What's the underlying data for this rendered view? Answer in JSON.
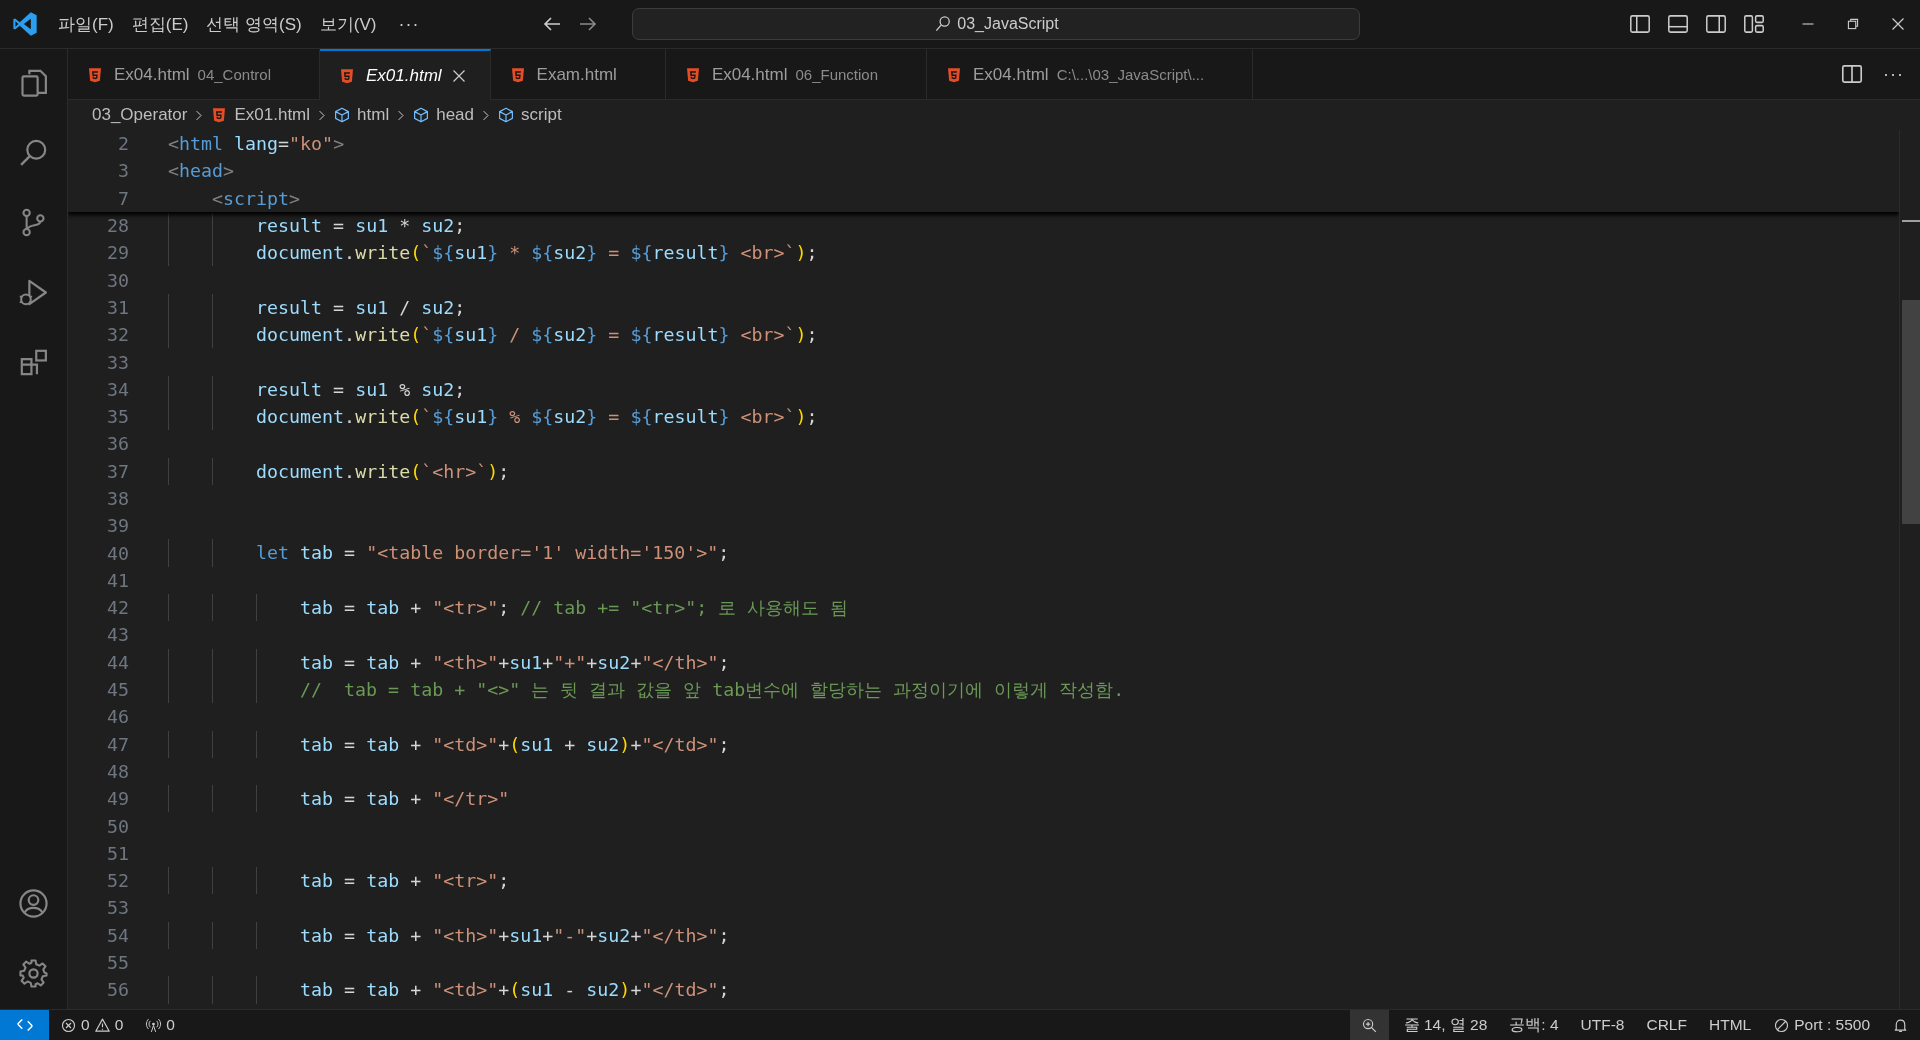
{
  "title_bar": {
    "menus": [
      "파일(F)",
      "편집(E)",
      "선택 영역(S)",
      "보기(V)"
    ],
    "more": "···",
    "search": "03_JavaScript"
  },
  "tabs": [
    {
      "name": "Ex04.html",
      "description": "04_Control",
      "selected": false,
      "preview": false
    },
    {
      "name": "Ex01.html",
      "selected": true,
      "preview": true
    },
    {
      "name": "Exam.html",
      "selected": false,
      "preview": false
    },
    {
      "name": "Ex04.html",
      "description": "06_Function",
      "selected": false,
      "preview": false
    },
    {
      "name": "Ex04.html",
      "description": "C:\\...\\03_JavaScript\\...",
      "selected": false,
      "preview": false
    }
  ],
  "tab_actions": {
    "more": "···"
  },
  "breadcrumbs": [
    {
      "kind": "folder",
      "text": "03_Operator"
    },
    {
      "kind": "file",
      "text": "Ex01.html"
    },
    {
      "kind": "symbol",
      "text": "html"
    },
    {
      "kind": "symbol",
      "text": "head"
    },
    {
      "kind": "symbol",
      "text": "script"
    }
  ],
  "sticky_lines": [
    {
      "number": "2",
      "tokens": [
        {
          "kind": "punct",
          "text": "<"
        },
        {
          "kind": "tag",
          "text": "html"
        },
        {
          "kind": "attr",
          "text": " lang"
        },
        {
          "kind": "plain",
          "text": "="
        },
        {
          "kind": "string",
          "text": "\"ko\""
        },
        {
          "kind": "punct",
          "text": ">"
        }
      ]
    },
    {
      "number": "3",
      "tokens": [
        {
          "kind": "punct",
          "text": "<"
        },
        {
          "kind": "tag",
          "text": "head"
        },
        {
          "kind": "punct",
          "text": ">"
        }
      ]
    },
    {
      "number": "7",
      "tokens": [
        {
          "kind": "punct",
          "text": "    <"
        },
        {
          "kind": "tag",
          "text": "script"
        },
        {
          "kind": "punct",
          "text": ">"
        }
      ]
    }
  ],
  "lines": [
    {
      "number": "28",
      "tokens": [
        {
          "kind": "variable",
          "text": "        result"
        },
        {
          "kind": "plain",
          "text": " = "
        },
        {
          "kind": "variable",
          "text": "su1"
        },
        {
          "kind": "plain",
          "text": " * "
        },
        {
          "kind": "variable",
          "text": "su2"
        },
        {
          "kind": "plain",
          "text": ";"
        }
      ]
    },
    {
      "number": "29",
      "tokens": [
        {
          "kind": "variable",
          "text": "        document"
        },
        {
          "kind": "plain",
          "text": "."
        },
        {
          "kind": "function",
          "text": "write"
        },
        {
          "kind": "bracket",
          "text": "("
        },
        {
          "kind": "string",
          "text": "`"
        },
        {
          "kind": "interp",
          "text": "${"
        },
        {
          "kind": "variable",
          "text": "su1"
        },
        {
          "kind": "interp",
          "text": "}"
        },
        {
          "kind": "string",
          "text": " * "
        },
        {
          "kind": "interp",
          "text": "${"
        },
        {
          "kind": "variable",
          "text": "su2"
        },
        {
          "kind": "interp",
          "text": "}"
        },
        {
          "kind": "string",
          "text": " = "
        },
        {
          "kind": "interp",
          "text": "${"
        },
        {
          "kind": "variable",
          "text": "result"
        },
        {
          "kind": "interp",
          "text": "}"
        },
        {
          "kind": "string",
          "text": " <br>`"
        },
        {
          "kind": "bracket",
          "text": ")"
        },
        {
          "kind": "plain",
          "text": ";"
        }
      ]
    },
    {
      "number": "30"
    },
    {
      "number": "31",
      "tokens": [
        {
          "kind": "variable",
          "text": "        result"
        },
        {
          "kind": "plain",
          "text": " = "
        },
        {
          "kind": "variable",
          "text": "su1"
        },
        {
          "kind": "plain",
          "text": " / "
        },
        {
          "kind": "variable",
          "text": "su2"
        },
        {
          "kind": "plain",
          "text": ";"
        }
      ]
    },
    {
      "number": "32",
      "tokens": [
        {
          "kind": "variable",
          "text": "        document"
        },
        {
          "kind": "plain",
          "text": "."
        },
        {
          "kind": "function",
          "text": "write"
        },
        {
          "kind": "bracket",
          "text": "("
        },
        {
          "kind": "string",
          "text": "`"
        },
        {
          "kind": "interp",
          "text": "${"
        },
        {
          "kind": "variable",
          "text": "su1"
        },
        {
          "kind": "interp",
          "text": "}"
        },
        {
          "kind": "string",
          "text": " / "
        },
        {
          "kind": "interp",
          "text": "${"
        },
        {
          "kind": "variable",
          "text": "su2"
        },
        {
          "kind": "interp",
          "text": "}"
        },
        {
          "kind": "string",
          "text": " = "
        },
        {
          "kind": "interp",
          "text": "${"
        },
        {
          "kind": "variable",
          "text": "result"
        },
        {
          "kind": "interp",
          "text": "}"
        },
        {
          "kind": "string",
          "text": " <br>`"
        },
        {
          "kind": "bracket",
          "text": ")"
        },
        {
          "kind": "plain",
          "text": ";"
        }
      ]
    },
    {
      "number": "33"
    },
    {
      "number": "34",
      "tokens": [
        {
          "kind": "variable",
          "text": "        result"
        },
        {
          "kind": "plain",
          "text": " = "
        },
        {
          "kind": "variable",
          "text": "su1"
        },
        {
          "kind": "plain",
          "text": " % "
        },
        {
          "kind": "variable",
          "text": "su2"
        },
        {
          "kind": "plain",
          "text": ";"
        }
      ]
    },
    {
      "number": "35",
      "tokens": [
        {
          "kind": "variable",
          "text": "        document"
        },
        {
          "kind": "plain",
          "text": "."
        },
        {
          "kind": "function",
          "text": "write"
        },
        {
          "kind": "bracket",
          "text": "("
        },
        {
          "kind": "string",
          "text": "`"
        },
        {
          "kind": "interp",
          "text": "${"
        },
        {
          "kind": "variable",
          "text": "su1"
        },
        {
          "kind": "interp",
          "text": "}"
        },
        {
          "kind": "string",
          "text": " % "
        },
        {
          "kind": "interp",
          "text": "${"
        },
        {
          "kind": "variable",
          "text": "su2"
        },
        {
          "kind": "interp",
          "text": "}"
        },
        {
          "kind": "string",
          "text": " = "
        },
        {
          "kind": "interp",
          "text": "${"
        },
        {
          "kind": "variable",
          "text": "result"
        },
        {
          "kind": "interp",
          "text": "}"
        },
        {
          "kind": "string",
          "text": " <br>`"
        },
        {
          "kind": "bracket",
          "text": ")"
        },
        {
          "kind": "plain",
          "text": ";"
        }
      ]
    },
    {
      "number": "36"
    },
    {
      "number": "37",
      "tokens": [
        {
          "kind": "variable",
          "text": "        document"
        },
        {
          "kind": "plain",
          "text": "."
        },
        {
          "kind": "function",
          "text": "write"
        },
        {
          "kind": "bracket",
          "text": "("
        },
        {
          "kind": "string",
          "text": "`<hr>`"
        },
        {
          "kind": "bracket",
          "text": ")"
        },
        {
          "kind": "plain",
          "text": ";"
        }
      ]
    },
    {
      "number": "38"
    },
    {
      "number": "39"
    },
    {
      "number": "40",
      "tokens": [
        {
          "kind": "keyword",
          "text": "        let"
        },
        {
          "kind": "variable",
          "text": " tab"
        },
        {
          "kind": "plain",
          "text": " = "
        },
        {
          "kind": "string",
          "text": "\"<table border='1' width='150'>\""
        },
        {
          "kind": "plain",
          "text": ";"
        }
      ]
    },
    {
      "number": "41"
    },
    {
      "number": "42",
      "tokens": [
        {
          "kind": "variable",
          "text": "            tab"
        },
        {
          "kind": "plain",
          "text": " = "
        },
        {
          "kind": "variable",
          "text": "tab"
        },
        {
          "kind": "plain",
          "text": " + "
        },
        {
          "kind": "string",
          "text": "\"<tr>\""
        },
        {
          "kind": "plain",
          "text": ";"
        },
        {
          "kind": "comment",
          "text": " // tab += \"<tr>\"; 로 사용해도 됨"
        }
      ]
    },
    {
      "number": "43"
    },
    {
      "number": "44",
      "tokens": [
        {
          "kind": "variable",
          "text": "            tab"
        },
        {
          "kind": "plain",
          "text": " = "
        },
        {
          "kind": "variable",
          "text": "tab"
        },
        {
          "kind": "plain",
          "text": " + "
        },
        {
          "kind": "string",
          "text": "\"<th>\""
        },
        {
          "kind": "plain",
          "text": "+"
        },
        {
          "kind": "variable",
          "text": "su1"
        },
        {
          "kind": "plain",
          "text": "+"
        },
        {
          "kind": "string",
          "text": "\"+\""
        },
        {
          "kind": "plain",
          "text": "+"
        },
        {
          "kind": "variable",
          "text": "su2"
        },
        {
          "kind": "plain",
          "text": "+"
        },
        {
          "kind": "string",
          "text": "\"</th>\""
        },
        {
          "kind": "plain",
          "text": ";"
        }
      ]
    },
    {
      "number": "45",
      "tokens": [
        {
          "kind": "comment",
          "text": "            //  tab = tab + \"<>\" 는 뒷 결과 값을 앞 tab변수에 할당하는 과정이기에 이렇게 작성함."
        }
      ]
    },
    {
      "number": "46"
    },
    {
      "number": "47",
      "tokens": [
        {
          "kind": "variable",
          "text": "            tab"
        },
        {
          "kind": "plain",
          "text": " = "
        },
        {
          "kind": "variable",
          "text": "tab"
        },
        {
          "kind": "plain",
          "text": " + "
        },
        {
          "kind": "string",
          "text": "\"<td>\""
        },
        {
          "kind": "plain",
          "text": "+"
        },
        {
          "kind": "bracket",
          "text": "("
        },
        {
          "kind": "variable",
          "text": "su1"
        },
        {
          "kind": "plain",
          "text": " + "
        },
        {
          "kind": "variable",
          "text": "su2"
        },
        {
          "kind": "bracket",
          "text": ")"
        },
        {
          "kind": "plain",
          "text": "+"
        },
        {
          "kind": "string",
          "text": "\"</td>\""
        },
        {
          "kind": "plain",
          "text": ";"
        }
      ]
    },
    {
      "number": "48"
    },
    {
      "number": "49",
      "tokens": [
        {
          "kind": "variable",
          "text": "            tab"
        },
        {
          "kind": "plain",
          "text": " = "
        },
        {
          "kind": "variable",
          "text": "tab"
        },
        {
          "kind": "plain",
          "text": " + "
        },
        {
          "kind": "string",
          "text": "\"</tr>\""
        }
      ]
    },
    {
      "number": "50"
    },
    {
      "number": "51"
    },
    {
      "number": "52",
      "tokens": [
        {
          "kind": "variable",
          "text": "            tab"
        },
        {
          "kind": "plain",
          "text": " = "
        },
        {
          "kind": "variable",
          "text": "tab"
        },
        {
          "kind": "plain",
          "text": " + "
        },
        {
          "kind": "string",
          "text": "\"<tr>\""
        },
        {
          "kind": "plain",
          "text": ";"
        }
      ]
    },
    {
      "number": "53"
    },
    {
      "number": "54",
      "tokens": [
        {
          "kind": "variable",
          "text": "            tab"
        },
        {
          "kind": "plain",
          "text": " = "
        },
        {
          "kind": "variable",
          "text": "tab"
        },
        {
          "kind": "plain",
          "text": " + "
        },
        {
          "kind": "string",
          "text": "\"<th>\""
        },
        {
          "kind": "plain",
          "text": "+"
        },
        {
          "kind": "variable",
          "text": "su1"
        },
        {
          "kind": "plain",
          "text": "+"
        },
        {
          "kind": "string",
          "text": "\"-\""
        },
        {
          "kind": "plain",
          "text": "+"
        },
        {
          "kind": "variable",
          "text": "su2"
        },
        {
          "kind": "plain",
          "text": "+"
        },
        {
          "kind": "string",
          "text": "\"</th>\""
        },
        {
          "kind": "plain",
          "text": ";"
        }
      ]
    },
    {
      "number": "55"
    },
    {
      "number": "56",
      "tokens": [
        {
          "kind": "variable",
          "text": "            tab"
        },
        {
          "kind": "plain",
          "text": " = "
        },
        {
          "kind": "variable",
          "text": "tab"
        },
        {
          "kind": "plain",
          "text": " + "
        },
        {
          "kind": "string",
          "text": "\"<td>\""
        },
        {
          "kind": "plain",
          "text": "+"
        },
        {
          "kind": "bracket",
          "text": "("
        },
        {
          "kind": "variable",
          "text": "su1"
        },
        {
          "kind": "plain",
          "text": " - "
        },
        {
          "kind": "variable",
          "text": "su2"
        },
        {
          "kind": "bracket",
          "text": ")"
        },
        {
          "kind": "plain",
          "text": "+"
        },
        {
          "kind": "string",
          "text": "\"</td>\""
        },
        {
          "kind": "plain",
          "text": ";"
        }
      ]
    }
  ],
  "status_bar": {
    "errors": "0",
    "warnings": "0",
    "ports": "0",
    "items": [
      {
        "kind": "zoom"
      },
      {
        "kind": "text",
        "text": "줄 14, 열 28"
      },
      {
        "kind": "text",
        "text": "공백: 4"
      },
      {
        "kind": "text",
        "text": "UTF-8"
      },
      {
        "kind": "text",
        "text": "CRLF"
      },
      {
        "kind": "text",
        "text": "HTML"
      },
      {
        "kind": "port",
        "text": "Port : 5500"
      },
      {
        "kind": "bell"
      }
    ]
  }
}
